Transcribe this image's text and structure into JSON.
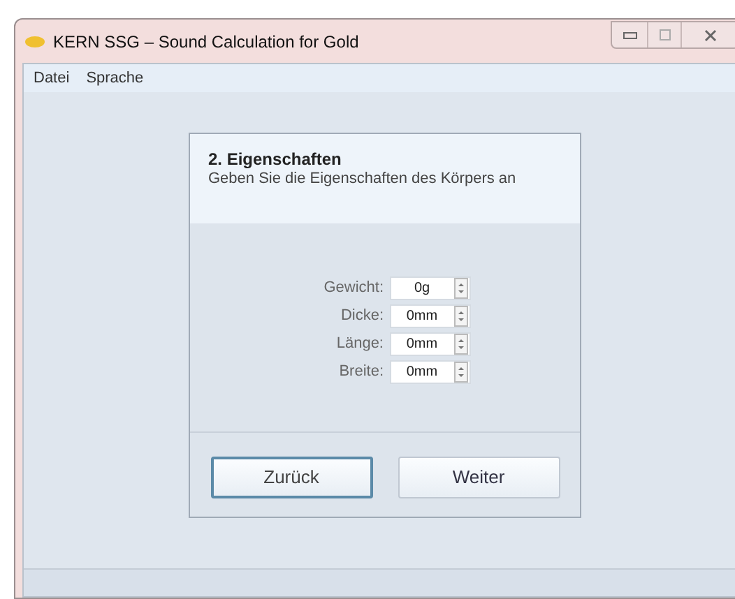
{
  "window": {
    "title": "KERN SSG – Sound Calculation for Gold"
  },
  "menu": [
    "Datei",
    "Sprache"
  ],
  "dialog": {
    "title": "2. Eigenschaften",
    "subtitle": "Geben Sie die Eigenschaften des Körpers an",
    "fields": [
      {
        "label": "Gewicht:",
        "value": "0g"
      },
      {
        "label": "Dicke:",
        "value": "0mm"
      },
      {
        "label": "Länge:",
        "value": "0mm"
      },
      {
        "label": "Breite:",
        "value": "0mm"
      }
    ],
    "buttons": [
      {
        "label": "Zurück",
        "focused": true
      },
      {
        "label": "Weiter",
        "focused": false
      }
    ]
  }
}
